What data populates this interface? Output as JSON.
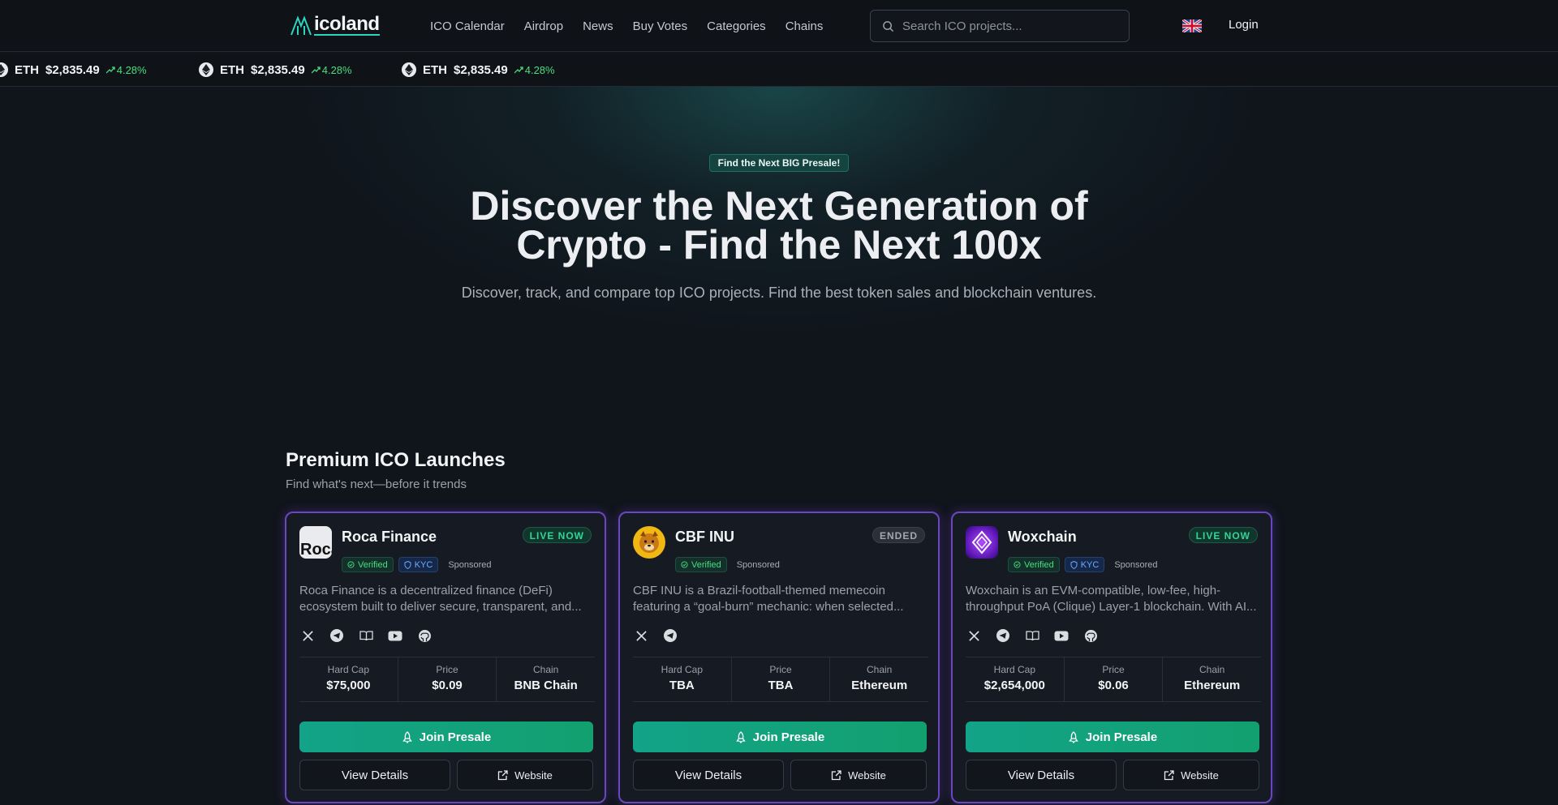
{
  "nav": {
    "logo_text": "icoland",
    "links": [
      "ICO Calendar",
      "Airdrop",
      "News",
      "Buy Votes",
      "Categories",
      "Chains"
    ],
    "search_placeholder": "Search ICO projects...",
    "login_label": "Login"
  },
  "ticker": {
    "items": [
      {
        "symbol": "ETH",
        "price": "$2,835.49",
        "change": "4.28%"
      },
      {
        "symbol": "ETH",
        "price": "$2,835.49",
        "change": "4.28%"
      },
      {
        "symbol": "ETH",
        "price": "$2,835.49",
        "change": "4.28%"
      }
    ]
  },
  "hero": {
    "badge": "Find the Next BIG Presale!",
    "title_line1": "Discover the Next Generation of",
    "title_line2": "Crypto - Find the Next 100x",
    "subtitle": "Discover, track, and compare top ICO projects. Find the best token sales and blockchain ventures."
  },
  "premium": {
    "title": "Premium ICO Launches",
    "subtitle": "Find what's next—before it trends"
  },
  "cards": [
    {
      "name": "Roca Finance",
      "logo_text": "Roca",
      "status": "LIVE NOW",
      "tags": [
        "Verified",
        "KYC",
        "Sponsored"
      ],
      "description": "Roca Finance is a decentralized finance (DeFi) ecosystem built to deliver secure, transparent, and...",
      "stats": [
        {
          "label": "Hard Cap",
          "value": "$75,000"
        },
        {
          "label": "Price",
          "value": "$0.09"
        },
        {
          "label": "Chain",
          "value": "BNB Chain"
        }
      ],
      "join_label": "Join Presale",
      "details_label": "View Details",
      "website_label": "Website"
    },
    {
      "name": "CBF INU",
      "status": "ENDED",
      "tags": [
        "Verified",
        "Sponsored"
      ],
      "description": "CBF INU is a Brazil-football-themed memecoin featuring a “goal-burn” mechanic: when selected...",
      "stats": [
        {
          "label": "Hard Cap",
          "value": "TBA"
        },
        {
          "label": "Price",
          "value": "TBA"
        },
        {
          "label": "Chain",
          "value": "Ethereum"
        }
      ],
      "join_label": "Join Presale",
      "details_label": "View Details",
      "website_label": "Website"
    },
    {
      "name": "Woxchain",
      "status": "LIVE NOW",
      "tags": [
        "Verified",
        "KYC",
        "Sponsored"
      ],
      "description": "Woxchain is an EVM-compatible, low-fee, high-throughput PoA (Clique) Layer-1 blockchain. With AI...",
      "stats": [
        {
          "label": "Hard Cap",
          "value": "$2,654,000"
        },
        {
          "label": "Price",
          "value": "$0.06"
        },
        {
          "label": "Chain",
          "value": "Ethereum"
        }
      ],
      "join_label": "Join Presale",
      "details_label": "View Details",
      "website_label": "Website"
    }
  ],
  "colors": {
    "accent": "#12a388",
    "card_border": "#6b46c1",
    "positive": "#4ade80",
    "background": "#10141b"
  }
}
